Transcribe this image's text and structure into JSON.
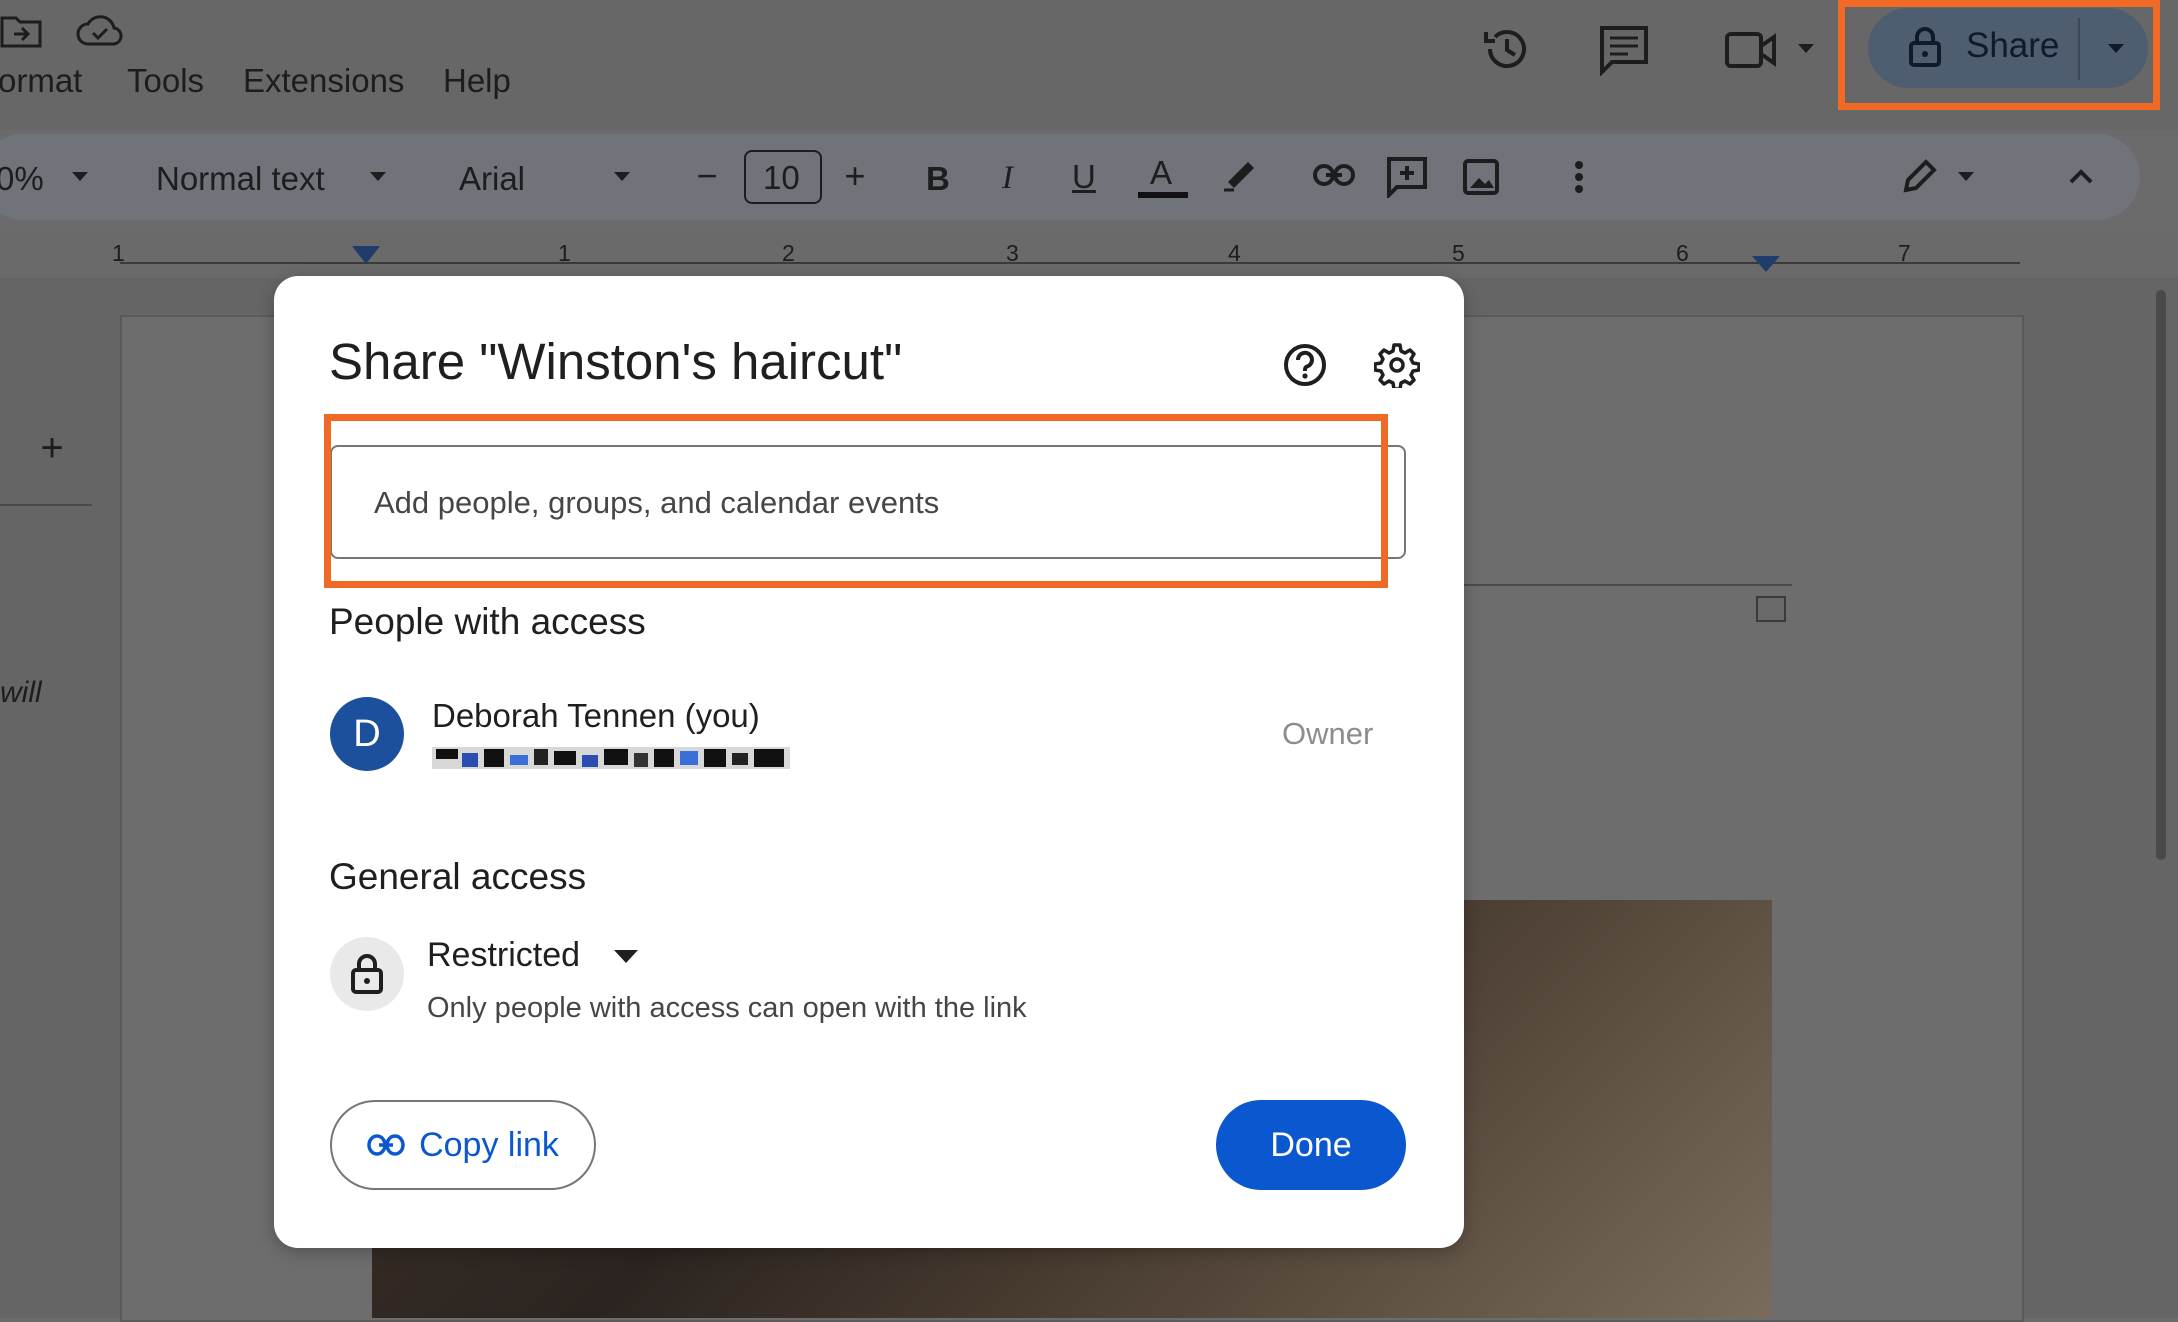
{
  "menu": [
    "ormat",
    "Tools",
    "Extensions",
    "Help"
  ],
  "header": {
    "share_label": "Share"
  },
  "toolbar": {
    "zoom": "0%",
    "style": "Normal text",
    "font": "Arial",
    "font_size": "10",
    "bold": "B",
    "italic": "I",
    "underline": "U",
    "text_color": "A"
  },
  "ruler": [
    "1",
    "1",
    "2",
    "3",
    "4",
    "5",
    "6",
    "7"
  ],
  "doc": {
    "side_text": "will"
  },
  "dialog": {
    "title": "Share \"Winston's haircut\"",
    "input_placeholder": "Add people, groups, and calendar events",
    "people_heading": "People with access",
    "person": {
      "initial": "D",
      "name": "Deborah Tennen (you)",
      "role": "Owner"
    },
    "general_heading": "General access",
    "access": {
      "level": "Restricted",
      "description": "Only people with access can open with the link"
    },
    "copy_link_label": "Copy link",
    "done_label": "Done"
  },
  "colors": {
    "highlight": "#f06a25",
    "primary": "#0b57d0",
    "avatar": "#1c4f9c"
  }
}
